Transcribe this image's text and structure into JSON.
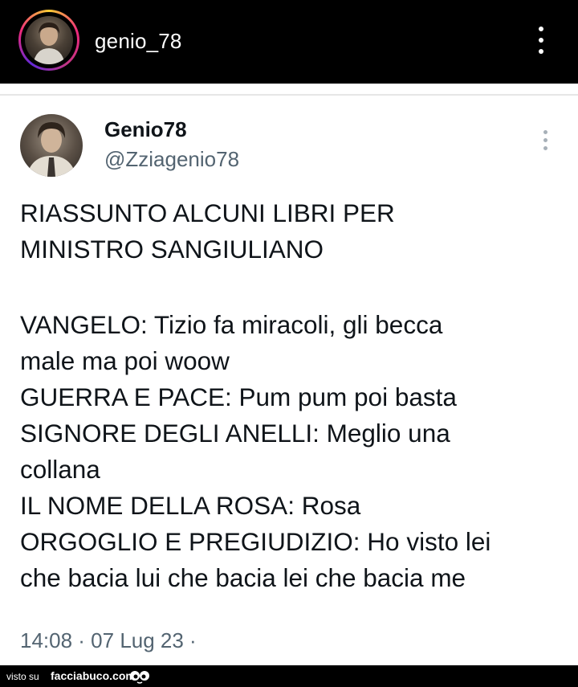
{
  "instagram_header": {
    "username": "genio_78",
    "icons": {
      "menu": "more-vertical-icon"
    }
  },
  "tweet": {
    "display_name": "Genio78",
    "handle": "@Zziagenio78",
    "icons": {
      "menu": "more-vertical-icon"
    },
    "lines": [
      "RIASSUNTO ALCUNI LIBRI PER",
      "MINISTRO SANGIULIANO",
      "",
      "VANGELO: Tizio fa miracoli, gli becca",
      "male ma poi woow",
      "GUERRA E PACE: Pum pum poi basta",
      "SIGNORE DEGLI ANELLI: Meglio una",
      "collana",
      "IL NOME DELLA ROSA: Rosa",
      "ORGOGLIO E PREGIUDIZIO: Ho visto lei",
      "che bacia lui che bacia lei che bacia me"
    ],
    "timestamp": "14:08 · 07 Lug 23 ·"
  },
  "footer": {
    "prefix": "visto su",
    "site": "facciabuco.com",
    "logo_icon": "eyes-logo-icon"
  },
  "colors": {
    "header_bg": "#000000",
    "text_primary": "#0f1419",
    "text_secondary": "#536471"
  }
}
